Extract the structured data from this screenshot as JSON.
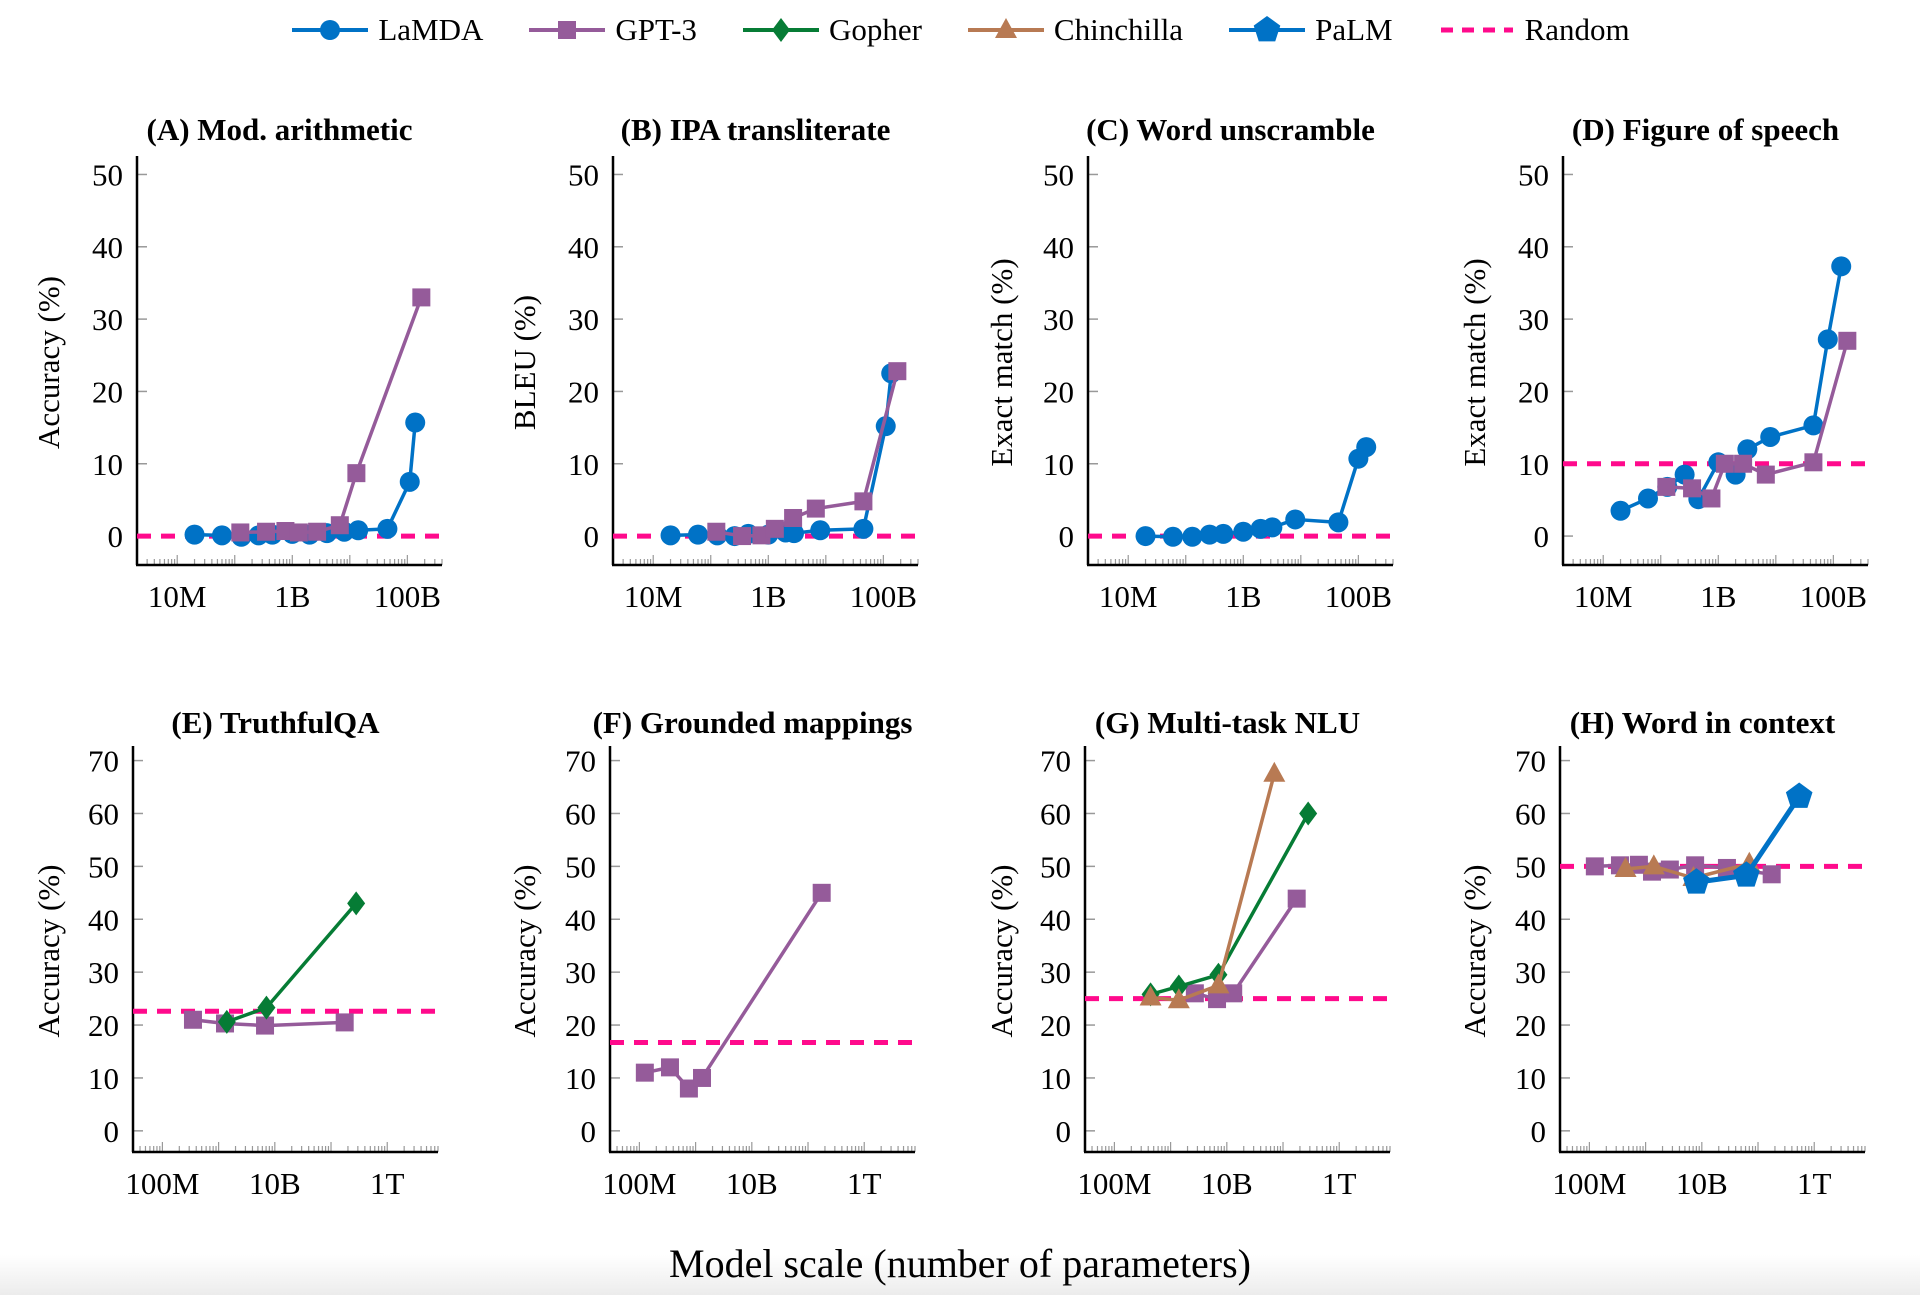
{
  "legend": [
    {
      "name": "LaMDA",
      "color": "#0072c6",
      "marker": "circle-icon"
    },
    {
      "name": "GPT-3",
      "color": "#955b9a",
      "marker": "square-icon"
    },
    {
      "name": "Gopher",
      "color": "#067c35",
      "marker": "diamond-icon"
    },
    {
      "name": "Chinchilla",
      "color": "#b87a53",
      "marker": "triangle-icon"
    },
    {
      "name": "PaLM",
      "color": "#0072c6",
      "marker": "pentagon-icon"
    },
    {
      "name": "Random",
      "color": "#ff0a8c",
      "marker": "dashed-line-icon"
    }
  ],
  "global_xlabel": "Model scale (number of parameters)",
  "chart_data": [
    {
      "type": "line",
      "title": "(A) Mod. arithmetic",
      "ylabel": "Accuracy (%)",
      "xlabel": "",
      "xscale": "log",
      "xlim": [
        2000000.0,
        400000000000.0
      ],
      "ylim": [
        -4,
        52
      ],
      "yticks": [
        0,
        10,
        20,
        30,
        40,
        50
      ],
      "xticks": [
        {
          "v": 10000000.0,
          "label": "10M"
        },
        {
          "v": 1000000000.0,
          "label": "1B"
        },
        {
          "v": 100000000000.0,
          "label": "100B"
        }
      ],
      "random": 0,
      "series": [
        {
          "name": "LaMDA",
          "x": [
            20000000.0,
            60000000.0,
            130000000.0,
            260000000.0,
            450000000.0,
            1000000000.0,
            2000000000.0,
            4000000000.0,
            8000000000.0,
            14000000000.0,
            45000000000.0,
            110000000000.0,
            137000000000.0
          ],
          "y": [
            0.2,
            0.1,
            -0.1,
            0.1,
            0.2,
            0.3,
            0.2,
            0.4,
            0.6,
            0.8,
            1.0,
            7.5,
            15.7
          ]
        },
        {
          "name": "GPT-3",
          "x": [
            125000000.0,
            350000000.0,
            760000000.0,
            1300000000.0,
            2700000000.0,
            6700000000.0,
            13000000000.0,
            175000000000.0
          ],
          "y": [
            0.5,
            0.6,
            0.7,
            0.5,
            0.6,
            1.5,
            8.7,
            33.0
          ]
        }
      ]
    },
    {
      "type": "line",
      "title": "(B) IPA transliterate",
      "ylabel": "BLEU (%)",
      "xlabel": "",
      "xscale": "log",
      "xlim": [
        2000000.0,
        400000000000.0
      ],
      "ylim": [
        -4,
        52
      ],
      "yticks": [
        0,
        10,
        20,
        30,
        40,
        50
      ],
      "xticks": [
        {
          "v": 10000000.0,
          "label": "10M"
        },
        {
          "v": 1000000000.0,
          "label": "1B"
        },
        {
          "v": 100000000000.0,
          "label": "100B"
        }
      ],
      "random": 0,
      "series": [
        {
          "name": "LaMDA",
          "x": [
            20000000.0,
            60000000.0,
            130000000.0,
            260000000.0,
            450000000.0,
            1000000000.0,
            2000000000.0,
            2800000000.0,
            8000000000.0,
            45000000000.0,
            110000000000.0,
            137000000000.0
          ],
          "y": [
            0.1,
            0.2,
            0.1,
            0.0,
            0.3,
            0.2,
            0.5,
            0.4,
            0.8,
            1.0,
            15.2,
            22.5
          ]
        },
        {
          "name": "GPT-3",
          "x": [
            125000000.0,
            350000000.0,
            760000000.0,
            1300000000.0,
            2700000000.0,
            6700000000.0,
            45000000000.0,
            175000000000.0
          ],
          "y": [
            0.6,
            0.0,
            0.1,
            1.0,
            2.5,
            3.8,
            4.8,
            22.8
          ]
        }
      ]
    },
    {
      "type": "line",
      "title": "(C) Word unscramble",
      "ylabel": "Exact match (%)",
      "xlabel": "",
      "xscale": "log",
      "xlim": [
        2000000.0,
        400000000000.0
      ],
      "ylim": [
        -4,
        52
      ],
      "yticks": [
        0,
        10,
        20,
        30,
        40,
        50
      ],
      "xticks": [
        {
          "v": 10000000.0,
          "label": "10M"
        },
        {
          "v": 1000000000.0,
          "label": "1B"
        },
        {
          "v": 100000000000.0,
          "label": "100B"
        }
      ],
      "random": 0,
      "series": [
        {
          "name": "LaMDA",
          "x": [
            20000000.0,
            60000000.0,
            130000000.0,
            260000000.0,
            450000000.0,
            1000000000.0,
            2000000000.0,
            3200000000.0,
            8000000000.0,
            45000000000.0,
            100000000000.0,
            137000000000.0
          ],
          "y": [
            0.0,
            -0.1,
            -0.1,
            0.2,
            0.3,
            0.6,
            1.0,
            1.2,
            2.3,
            1.9,
            10.7,
            12.3
          ]
        }
      ]
    },
    {
      "type": "line",
      "title": "(D) Figure of speech",
      "ylabel": "Exact match (%)",
      "xlabel": "",
      "xscale": "log",
      "xlim": [
        2000000.0,
        400000000000.0
      ],
      "ylim": [
        -4,
        52
      ],
      "yticks": [
        0,
        10,
        20,
        30,
        40,
        50
      ],
      "xticks": [
        {
          "v": 10000000.0,
          "label": "10M"
        },
        {
          "v": 1000000000.0,
          "label": "1B"
        },
        {
          "v": 100000000000.0,
          "label": "100B"
        }
      ],
      "random": 10,
      "series": [
        {
          "name": "LaMDA",
          "x": [
            20000000.0,
            60000000.0,
            130000000.0,
            260000000.0,
            450000000.0,
            1000000000.0,
            2000000000.0,
            3200000000.0,
            8000000000.0,
            45000000000.0,
            80000000000.0,
            137000000000.0
          ],
          "y": [
            3.5,
            5.2,
            6.8,
            8.5,
            5.1,
            10.2,
            8.5,
            12.0,
            13.7,
            15.3,
            27.2,
            37.3
          ]
        },
        {
          "name": "GPT-3",
          "x": [
            125000000.0,
            350000000.0,
            760000000.0,
            1300000000.0,
            2700000000.0,
            6700000000.0,
            45000000000.0,
            175000000000.0
          ],
          "y": [
            6.8,
            6.6,
            5.2,
            10.0,
            10.0,
            8.5,
            10.2,
            27.0
          ]
        }
      ]
    },
    {
      "type": "line",
      "title": "(E) TruthfulQA",
      "ylabel": "Accuracy (%)",
      "xlabel": "",
      "xscale": "log",
      "xlim": [
        30000000.0,
        8000000000000.0
      ],
      "ylim": [
        -4,
        72
      ],
      "yticks": [
        0,
        10,
        20,
        30,
        40,
        50,
        60,
        70
      ],
      "xticks": [
        {
          "v": 100000000.0,
          "label": "100M"
        },
        {
          "v": 10000000000.0,
          "label": "10B"
        },
        {
          "v": 1000000000000.0,
          "label": "1T"
        }
      ],
      "random": 22.6,
      "series": [
        {
          "name": "GPT-3",
          "x": [
            350000000.0,
            1300000000.0,
            6700000000.0,
            175000000000.0
          ],
          "y": [
            21.0,
            20.3,
            19.9,
            20.5
          ]
        },
        {
          "name": "Gopher",
          "x": [
            1400000000.0,
            7100000000.0,
            280000000000.0
          ],
          "y": [
            20.6,
            23.3,
            43.0
          ]
        }
      ]
    },
    {
      "type": "line",
      "title": "(F) Grounded mappings",
      "ylabel": "Accuracy (%)",
      "xlabel": "",
      "xscale": "log",
      "xlim": [
        30000000.0,
        8000000000000.0
      ],
      "ylim": [
        -4,
        72
      ],
      "yticks": [
        0,
        10,
        20,
        30,
        40,
        50,
        60,
        70
      ],
      "xticks": [
        {
          "v": 100000000.0,
          "label": "100M"
        },
        {
          "v": 10000000000.0,
          "label": "10B"
        },
        {
          "v": 1000000000000.0,
          "label": "1T"
        }
      ],
      "random": 16.7,
      "series": [
        {
          "name": "GPT-3",
          "x": [
            125000000.0,
            350000000.0,
            760000000.0,
            1300000000.0,
            175000000000.0
          ],
          "y": [
            11.0,
            12.0,
            8.0,
            10.0,
            45.0
          ]
        }
      ]
    },
    {
      "type": "line",
      "title": "(G) Multi-task NLU",
      "ylabel": "Accuracy (%)",
      "xlabel": "",
      "xscale": "log",
      "xlim": [
        30000000.0,
        8000000000000.0
      ],
      "ylim": [
        -4,
        72
      ],
      "yticks": [
        0,
        10,
        20,
        30,
        40,
        50,
        60,
        70
      ],
      "xticks": [
        {
          "v": 100000000.0,
          "label": "100M"
        },
        {
          "v": 10000000000.0,
          "label": "10B"
        },
        {
          "v": 1000000000000.0,
          "label": "1T"
        }
      ],
      "random": 25,
      "series": [
        {
          "name": "GPT-3",
          "x": [
            2700000000.0,
            6700000000.0,
            13000000000.0,
            175000000000.0
          ],
          "y": [
            26.0,
            24.9,
            26.0,
            43.9
          ]
        },
        {
          "name": "Gopher",
          "x": [
            440000000.0,
            1400000000.0,
            7100000000.0,
            280000000000.0
          ],
          "y": [
            25.8,
            27.3,
            29.5,
            60.0
          ]
        },
        {
          "name": "Chinchilla",
          "x": [
            440000000.0,
            1400000000.0,
            7100000000.0,
            70000000000.0
          ],
          "y": [
            25.2,
            24.7,
            27.5,
            67.5
          ]
        }
      ]
    },
    {
      "type": "line",
      "title": "(H) Word in context",
      "ylabel": "Accuracy (%)",
      "xlabel": "",
      "xscale": "log",
      "xlim": [
        30000000.0,
        8000000000000.0
      ],
      "ylim": [
        -4,
        72
      ],
      "yticks": [
        0,
        10,
        20,
        30,
        40,
        50,
        60,
        70
      ],
      "xticks": [
        {
          "v": 100000000.0,
          "label": "100M"
        },
        {
          "v": 10000000000.0,
          "label": "10B"
        },
        {
          "v": 1000000000000.0,
          "label": "1T"
        }
      ],
      "random": 50,
      "series": [
        {
          "name": "GPT-3",
          "x": [
            125000000.0,
            350000000.0,
            760000000.0,
            1300000000.0,
            2700000000.0,
            7600000000.0,
            28000000000.0,
            175000000000.0
          ],
          "y": [
            50.0,
            50.2,
            50.3,
            49.0,
            49.4,
            50.2,
            49.7,
            48.5
          ]
        },
        {
          "name": "Chinchilla",
          "x": [
            440000000.0,
            1400000000.0,
            7100000000.0,
            70000000000.0
          ],
          "y": [
            49.5,
            50.0,
            47.8,
            50.5
          ]
        },
        {
          "name": "PaLM",
          "x": [
            8000000000.0,
            62000000000.0,
            540000000000.0
          ],
          "y": [
            47.0,
            48.3,
            63.2
          ]
        }
      ]
    }
  ]
}
